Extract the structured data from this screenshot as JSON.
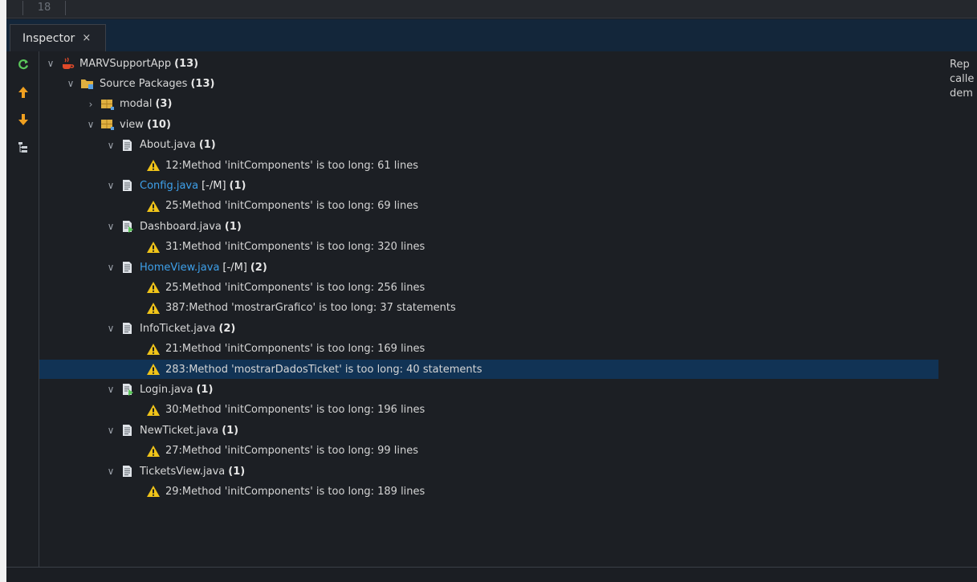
{
  "editor": {
    "line_number": "18"
  },
  "tab": {
    "title": "Inspector",
    "close_glyph": "×"
  },
  "toolbar": {
    "refresh_icon": "refresh-icon",
    "prev_icon": "arrow-up-icon",
    "next_icon": "arrow-down-icon",
    "tree_icon": "expand-tree-icon"
  },
  "tree": {
    "project": {
      "name": "MARVSupportApp",
      "count": "(13)"
    },
    "source_packages": {
      "name": "Source Packages",
      "count": "(13)"
    },
    "packages": [
      {
        "name": "modal",
        "count": "(3)",
        "expanded": false
      },
      {
        "name": "view",
        "count": "(10)",
        "expanded": true
      }
    ],
    "files": [
      {
        "name": "About.java",
        "flag": "",
        "count": "(1)",
        "modified": false,
        "icon": "java-file-icon",
        "warnings": [
          "12:Method 'initComponents' is too long: 61 lines"
        ]
      },
      {
        "name": "Config.java",
        "flag": "[-/M]",
        "count": "(1)",
        "modified": true,
        "icon": "java-file-icon",
        "warnings": [
          "25:Method 'initComponents' is too long: 69 lines"
        ]
      },
      {
        "name": "Dashboard.java",
        "flag": "",
        "count": "(1)",
        "modified": false,
        "icon": "main-class-file-icon",
        "warnings": [
          "31:Method 'initComponents' is too long: 320 lines"
        ]
      },
      {
        "name": "HomeView.java",
        "flag": "[-/M]",
        "count": "(2)",
        "modified": true,
        "icon": "java-file-icon",
        "warnings": [
          "25:Method 'initComponents' is too long: 256 lines",
          "387:Method 'mostrarGrafico' is too long: 37 statements"
        ]
      },
      {
        "name": "InfoTicket.java",
        "flag": "",
        "count": "(2)",
        "modified": false,
        "icon": "java-file-icon",
        "warnings": [
          "21:Method 'initComponents' is too long: 169 lines",
          "283:Method 'mostrarDadosTicket' is too long: 40 statements"
        ]
      },
      {
        "name": "Login.java",
        "flag": "",
        "count": "(1)",
        "modified": false,
        "icon": "main-class-file-icon",
        "warnings": [
          "30:Method 'initComponents' is too long: 196 lines"
        ]
      },
      {
        "name": "NewTicket.java",
        "flag": "",
        "count": "(1)",
        "modified": false,
        "icon": "java-file-icon",
        "warnings": [
          "27:Method 'initComponents' is too long: 99 lines"
        ]
      },
      {
        "name": "TicketsView.java",
        "flag": "",
        "count": "(1)",
        "modified": false,
        "icon": "java-file-icon",
        "warnings": [
          "29:Method 'initComponents' is too long: 189 lines"
        ]
      }
    ],
    "selected_warning": "283:Method 'mostrarDadosTicket' is too long: 40 statements"
  },
  "side_panel": {
    "lines": [
      "Rep",
      "calle",
      "dem"
    ]
  },
  "colors": {
    "modified_file": "#3ea0ea",
    "selection": "#113355",
    "tab_bar": "#13263a",
    "warning": "#f0c419"
  }
}
